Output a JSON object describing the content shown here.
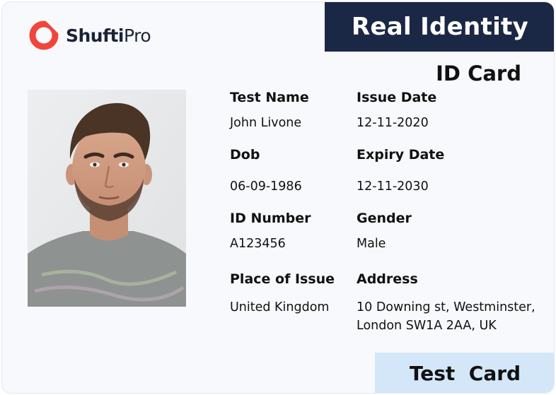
{
  "brand": {
    "name_bold": "Shufti",
    "name_light": "Pro",
    "logo_icon": "shuftipro-ring-icon",
    "accent_color": "#f0463c"
  },
  "header": {
    "title": "Real Identity",
    "background_color": "#1b2845"
  },
  "card_type": "ID Card",
  "photo": {
    "icon": "portrait-photo"
  },
  "fields": {
    "name": {
      "label": "Test Name",
      "value": "John Livone"
    },
    "issue_date": {
      "label": "Issue Date",
      "value": "12-11-2020"
    },
    "dob": {
      "label": "Dob",
      "value": "06-09-1986"
    },
    "expiry_date": {
      "label": "Expiry Date",
      "value": "12-11-2030"
    },
    "id_number": {
      "label": "ID Number",
      "value": "A123456"
    },
    "gender": {
      "label": "Gender",
      "value": "Male"
    },
    "place_of_issue": {
      "label": "Place of Issue",
      "value": "United Kingdom"
    },
    "address": {
      "label": "Address",
      "line1": "10 Downing st, Westminster,",
      "line2": "London SW1A 2AA, UK"
    }
  },
  "footer": {
    "label": "Test  Card",
    "background_color": "#d4e7f8"
  }
}
